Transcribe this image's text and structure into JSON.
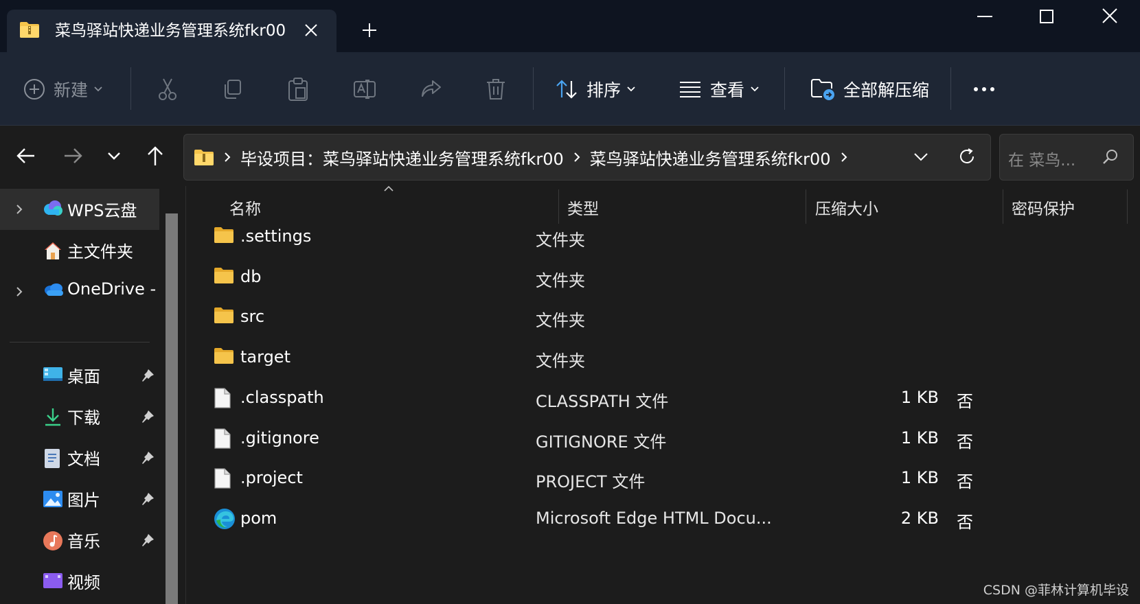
{
  "window": {
    "tab_title": "菜鸟驿站快递业务管理系统fkr00",
    "controls": [
      "minimize",
      "maximize",
      "close"
    ]
  },
  "toolbar": {
    "new_label": "新建",
    "sort_label": "排序",
    "view_label": "查看",
    "extract_label": "全部解压缩",
    "more_icon": "ellipsis-icon",
    "icons": [
      "cut-icon",
      "copy-icon",
      "paste-icon",
      "rename-icon",
      "share-icon",
      "delete-icon"
    ]
  },
  "address": {
    "crumbs": [
      "毕设项目：菜鸟驿站快递业务管理系统fkr00",
      "菜鸟驿站快递业务管理系统fkr00"
    ],
    "search_placeholder": "在 菜鸟..."
  },
  "sidebar": {
    "items": [
      {
        "label": "WPS云盘",
        "icon": "wps-cloud-icon"
      },
      {
        "label": "主文件夹",
        "icon": "home-icon"
      },
      {
        "label": "OneDrive -",
        "icon": "onedrive-icon"
      },
      {
        "label": "桌面",
        "icon": "desktop-icon"
      },
      {
        "label": "下载",
        "icon": "download-icon"
      },
      {
        "label": "文档",
        "icon": "documents-icon"
      },
      {
        "label": "图片",
        "icon": "pictures-icon"
      },
      {
        "label": "音乐",
        "icon": "music-icon"
      },
      {
        "label": "视频",
        "icon": "video-icon"
      }
    ]
  },
  "columns": {
    "name": "名称",
    "type": "类型",
    "size": "压缩大小",
    "protect": "密码保护"
  },
  "files": [
    {
      "name": ".settings",
      "type": "文件夹",
      "size": "",
      "protect": "",
      "icon": "folder-icon"
    },
    {
      "name": "db",
      "type": "文件夹",
      "size": "",
      "protect": "",
      "icon": "folder-icon"
    },
    {
      "name": "src",
      "type": "文件夹",
      "size": "",
      "protect": "",
      "icon": "folder-icon"
    },
    {
      "name": "target",
      "type": "文件夹",
      "size": "",
      "protect": "",
      "icon": "folder-icon"
    },
    {
      "name": ".classpath",
      "type": "CLASSPATH 文件",
      "size": "1 KB",
      "protect": "否",
      "icon": "file-icon"
    },
    {
      "name": ".gitignore",
      "type": "GITIGNORE 文件",
      "size": "1 KB",
      "protect": "否",
      "icon": "file-icon"
    },
    {
      "name": ".project",
      "type": "PROJECT 文件",
      "size": "1 KB",
      "protect": "否",
      "icon": "file-icon"
    },
    {
      "name": "pom",
      "type": "Microsoft Edge HTML Docu...",
      "size": "2 KB",
      "protect": "否",
      "icon": "edge-icon"
    }
  ],
  "watermark": "CSDN @菲林计算机毕设",
  "colors": {
    "titlebar": "#0e1420",
    "toolbar": "#1e2634",
    "content": "#1c1c1c",
    "folder": "#f5c44b",
    "accent": "#4aa3f0"
  }
}
